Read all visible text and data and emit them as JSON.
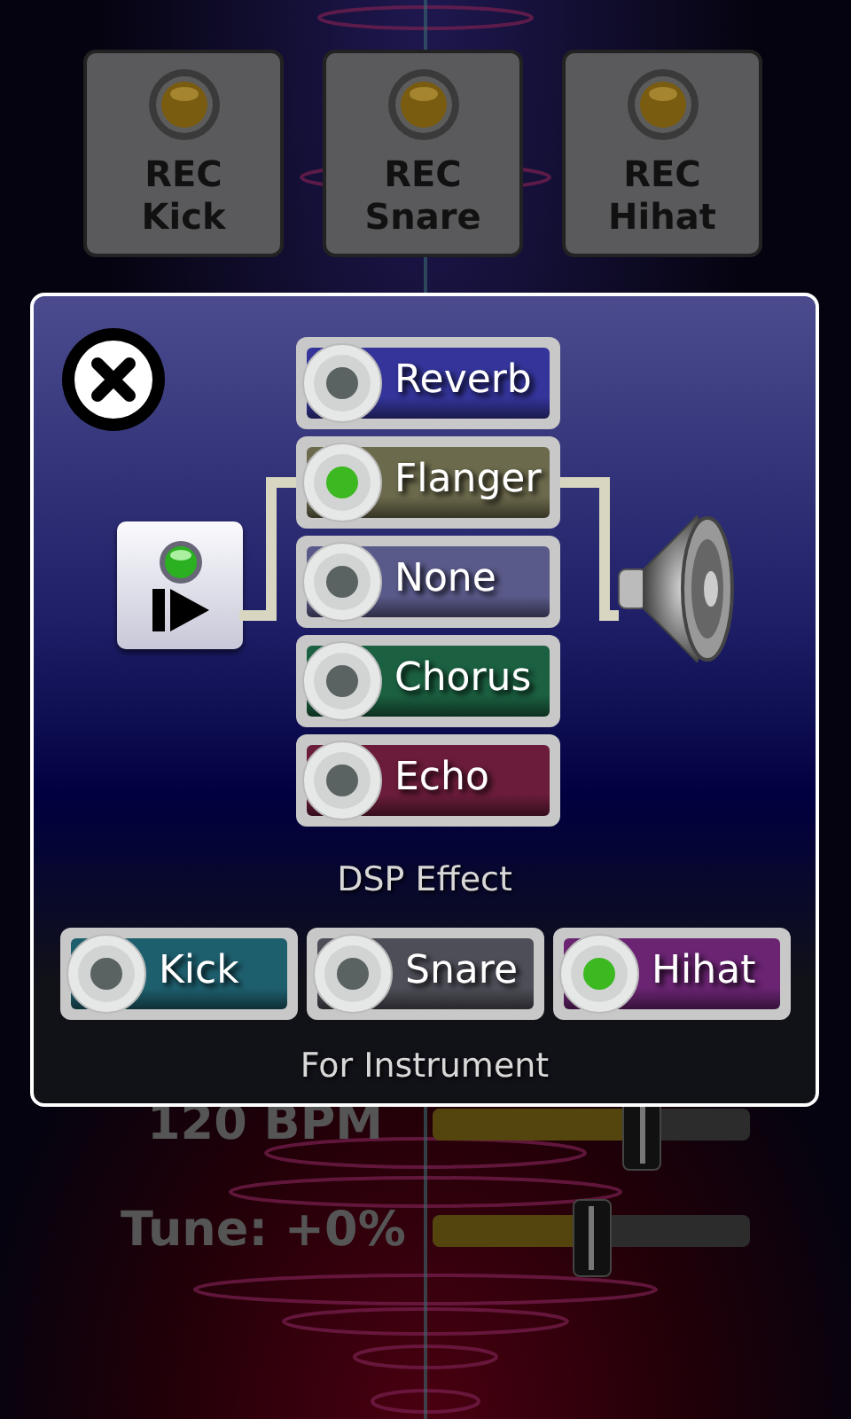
{
  "record_buttons": [
    {
      "label": "REC\nKick"
    },
    {
      "label": "REC\nSnare"
    },
    {
      "label": "REC\nHihat"
    }
  ],
  "sliders": [
    {
      "label": "120 BPM",
      "level": 0.66
    },
    {
      "label": "Tune: +0%",
      "level": 0.5
    }
  ],
  "dialog": {
    "effects": [
      {
        "label": "Reverb",
        "selected": false,
        "color": "#34349a"
      },
      {
        "label": "Flanger",
        "selected": true,
        "color": "#6c6a4c"
      },
      {
        "label": "None",
        "selected": false,
        "color": "#5a5a8a"
      },
      {
        "label": "Chorus",
        "selected": false,
        "color": "#1b6040"
      },
      {
        "label": "Echo",
        "selected": false,
        "color": "#6a1c3a"
      }
    ],
    "effect_caption": "DSP Effect",
    "instruments": [
      {
        "label": "Kick",
        "selected": false,
        "color": "#1e5f6e"
      },
      {
        "label": "Snare",
        "selected": false,
        "color": "#4e4e58"
      },
      {
        "label": "Hihat",
        "selected": true,
        "color": "#6a2472"
      }
    ],
    "instrument_caption": "For Instrument"
  }
}
